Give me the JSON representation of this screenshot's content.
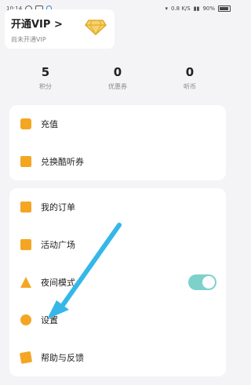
{
  "status_bar": {
    "time": "10:14",
    "network_speed": "0.8 K/S",
    "battery": "90%"
  },
  "vip": {
    "title": "开通VIP >",
    "subtitle": "尚未开通VIP",
    "badge_icon": "diamond-icon"
  },
  "stats": [
    {
      "value": "5",
      "label": "积分"
    },
    {
      "value": "0",
      "label": "优惠券"
    },
    {
      "value": "0",
      "label": "听币"
    }
  ],
  "menu_group1": [
    {
      "label": "充值",
      "icon": "wallet-icon"
    },
    {
      "label": "兑换酷听券",
      "icon": "ticket-icon"
    }
  ],
  "menu_group2": [
    {
      "label": "我的订单",
      "icon": "order-icon"
    },
    {
      "label": "活动广场",
      "icon": "event-icon"
    },
    {
      "label": "夜间模式",
      "icon": "night-mode-icon",
      "toggle_on": true
    },
    {
      "label": "设置",
      "icon": "settings-icon"
    },
    {
      "label": "帮助与反馈",
      "icon": "help-feedback-icon"
    }
  ],
  "colors": {
    "accent": "#f4a623",
    "toggle": "#7ed1cb",
    "arrow": "#35b7e8"
  }
}
